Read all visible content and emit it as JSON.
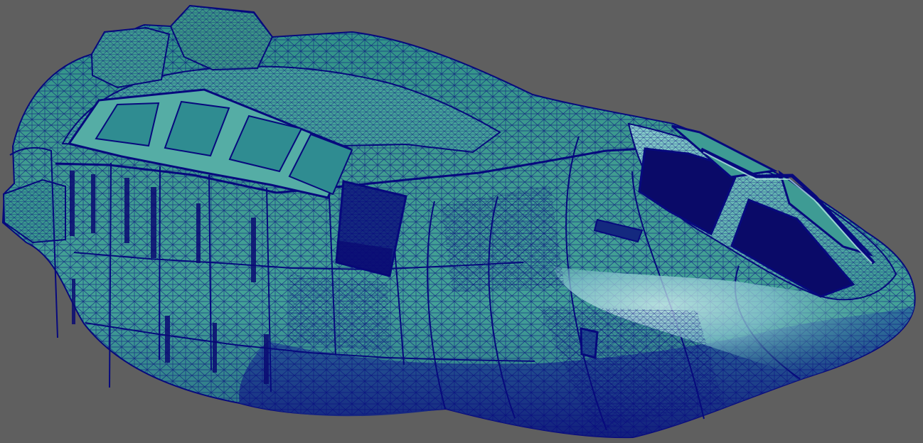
{
  "viewport": {
    "background": "#5f5f5f",
    "render_mode": "wireframe-on-shaded"
  },
  "model": {
    "subject": "spaceship-hull-mesh",
    "surface_color": "#3f9c8f",
    "highlight_color": "#9fdad6",
    "shadow_color": "#1d2f8f",
    "wire_color": "#06067e",
    "window_color": "#0b0b6a"
  }
}
